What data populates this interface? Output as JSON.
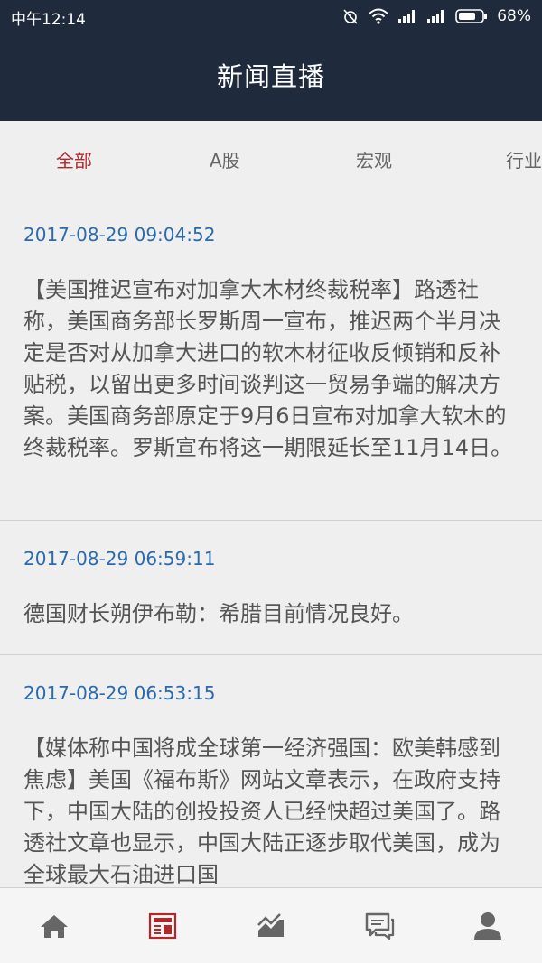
{
  "status_bar": {
    "time": "中午12:14",
    "battery": "68%",
    "icons": [
      "alarm-off-icon",
      "wifi-icon",
      "signal-icon",
      "signal-icon",
      "battery-icon"
    ]
  },
  "header": {
    "title": "新闻直播"
  },
  "tabs": [
    {
      "label": "全部",
      "active": true
    },
    {
      "label": "A股",
      "active": false
    },
    {
      "label": "宏观",
      "active": false
    },
    {
      "label": "行业",
      "active": false
    }
  ],
  "news": [
    {
      "timestamp": "2017-08-29 09:04:52",
      "content": "【美国推迟宣布对加拿大木材终裁税率】路透社称，美国商务部长罗斯周一宣布，推迟两个半月决定是否对从加拿大进口的软木材征收反倾销和反补贴税，以留出更多时间谈判这一贸易争端的解决方案。美国商务部原定于9月6日宣布对加拿大软木的终裁税率。罗斯宣布将这一期限延长至11月14日。"
    },
    {
      "timestamp": "2017-08-29 06:59:11",
      "content": "德国财长朔伊布勒：希腊目前情况良好。"
    },
    {
      "timestamp": "2017-08-29 06:53:15",
      "content": "【媒体称中国将成全球第一经济强国：欧美韩感到焦虑】美国《福布斯》网站文章表示，在政府支持下，中国大陆的创投投资人已经快超过美国了。路透社文章也显示，中国大陆正逐步取代美国，成为全球最大石油进口国"
    }
  ],
  "bottom_nav": [
    {
      "icon": "home-icon",
      "active": false
    },
    {
      "icon": "news-icon",
      "active": true
    },
    {
      "icon": "chart-icon",
      "active": false
    },
    {
      "icon": "chat-icon",
      "active": false
    },
    {
      "icon": "user-icon",
      "active": false
    }
  ],
  "colors": {
    "header_bg": "#1f2a3d",
    "accent": "#b3262a",
    "timestamp": "#2a6aaf",
    "nav_icon": "#666666"
  }
}
